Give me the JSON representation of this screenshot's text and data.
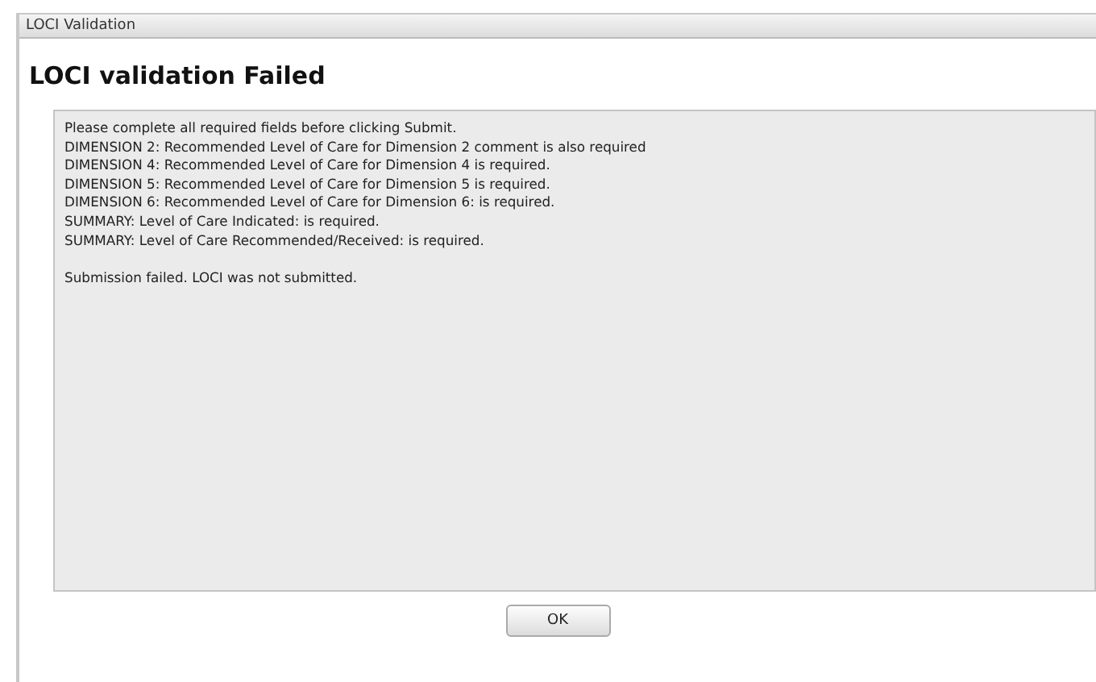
{
  "window": {
    "title": "LOCI Validation"
  },
  "heading": "LOCI validation Failed",
  "messages": [
    "Please complete all required fields before clicking Submit.",
    "DIMENSION 2: Recommended Level of Care for Dimension 2 comment is also required",
    "DIMENSION 4: Recommended Level of Care for Dimension 4 is required.",
    "DIMENSION 5: Recommended Level of Care for Dimension 5 is required.",
    "DIMENSION 6: Recommended Level of Care for Dimension 6: is required.",
    "SUMMARY: Level of Care Indicated: is required.",
    "SUMMARY: Level of Care Recommended/Received: is required."
  ],
  "result": "Submission failed. LOCI was not submitted.",
  "buttons": [
    "OK"
  ]
}
